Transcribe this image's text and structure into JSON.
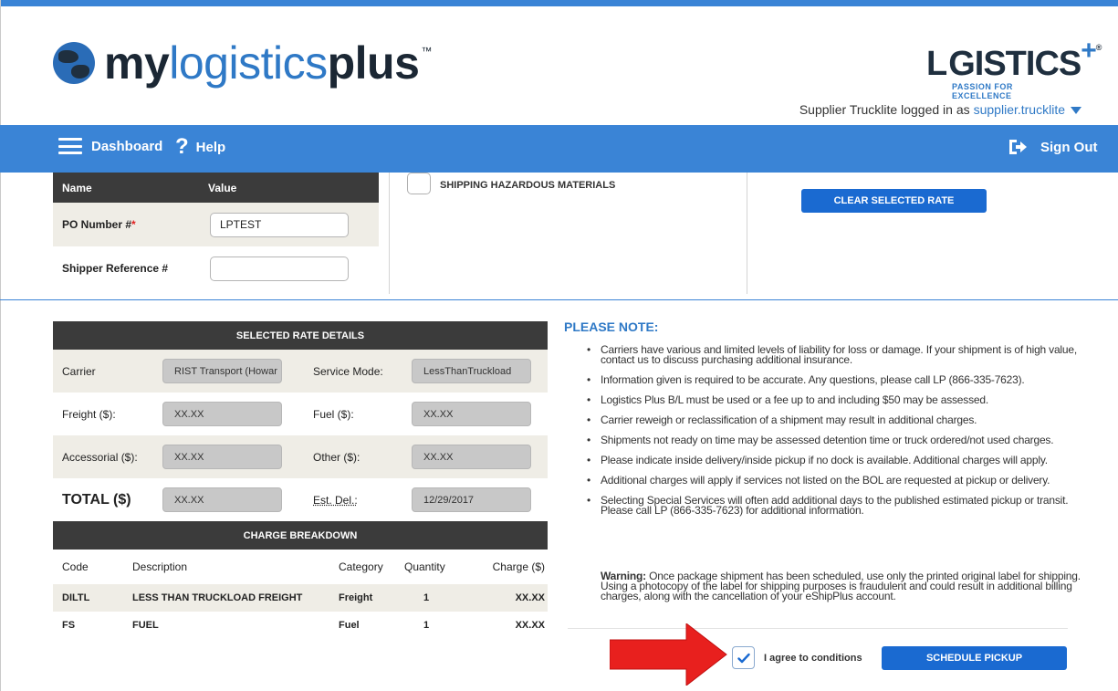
{
  "header": {
    "logo_my": "my",
    "logo_logistics": "logistics",
    "logo_plus": "plus",
    "logo_tm": "™",
    "brand_name_left": "L",
    "brand_name_right": "GISTICS",
    "brand_plus": "+",
    "brand_reg": "®",
    "brand_tagline": "PASSION FOR EXCELLENCE",
    "user_text": "Supplier Trucklite logged in as",
    "user_link": "supplier.trucklite"
  },
  "nav": {
    "dashboard_label": "Dashboard",
    "help_label": "Help",
    "help_glyph": "?",
    "signout_label": "Sign Out",
    "bar_color": "#3a84d6"
  },
  "references": {
    "col_name": "Name",
    "col_value": "Value",
    "po_label": "PO Number #",
    "po_required": "*",
    "po_value": "LPTEST",
    "shipper_label": "Shipper Reference #",
    "shipper_value": ""
  },
  "hazmat": {
    "label": "SHIPPING HAZARDOUS MATERIALS",
    "checked": false
  },
  "clear_rate_label": "CLEAR SELECTED RATE",
  "rate_details": {
    "title": "SELECTED RATE DETAILS",
    "carrier_label": "Carrier",
    "carrier_value": "RIST Transport (Howar",
    "service_label": "Service Mode:",
    "service_value": "LessThanTruckload",
    "freight_label": "Freight ($):",
    "freight_value": "XX.XX",
    "fuel_label": "Fuel ($):",
    "fuel_value": "XX.XX",
    "accessorial_label": "Accessorial ($):",
    "accessorial_value": "XX.XX",
    "other_label": "Other ($):",
    "other_value": "XX.XX",
    "total_label": "TOTAL ($)",
    "total_value": "XX.XX",
    "estdel_label": "Est. Del.:",
    "estdel_value": "12/29/2017"
  },
  "charges": {
    "title": "CHARGE BREAKDOWN",
    "headers": [
      "Code",
      "Description",
      "Category",
      "Quantity",
      "Charge ($)"
    ],
    "rows": [
      {
        "code": "DILTL",
        "description": "LESS THAN TRUCKLOAD FREIGHT",
        "category": "Freight",
        "quantity": "1",
        "charge": "XX.XX"
      },
      {
        "code": "FS",
        "description": "FUEL",
        "category": "Fuel",
        "quantity": "1",
        "charge": "XX.XX"
      }
    ]
  },
  "note": {
    "title": "PLEASE NOTE:",
    "items": [
      "Carriers have various and limited levels of liability for loss or damage. If your shipment is of high value, contact us to discuss purchasing additional insurance.",
      "Information given is required to be accurate. Any questions, please call LP (866-335-7623).",
      "Logistics Plus B/L must be used or a fee up to and including $50 may be assessed.",
      "Carrier reweigh or reclassification of a shipment may result in additional charges.",
      "Shipments not ready on time may be assessed detention time or truck ordered/not used charges.",
      "Please indicate inside delivery/inside pickup if no dock is available. Additional charges will apply.",
      "Additional charges will apply if services not listed on the BOL are requested at pickup or delivery.",
      "Selecting Special Services will often add additional days to the published estimated pickup or transit. Please call LP (866-335-7623) for additional information."
    ],
    "warning_label": "Warning:",
    "warning_text": " Once package shipment has been scheduled, use only the printed original label for shipping. Using a photocopy of the label for shipping purposes is fraudulent and could result in additional billing charges, along with the cancellation of your eShipPlus account."
  },
  "agree": {
    "label": "I agree to conditions",
    "checked": true
  },
  "schedule_label": "SCHEDULE PICKUP",
  "colors": {
    "primary_blue": "#3a84d6",
    "button_blue": "#1a6ad1",
    "dark_header": "#3b3b3b",
    "arrow_red": "#e8201e"
  }
}
